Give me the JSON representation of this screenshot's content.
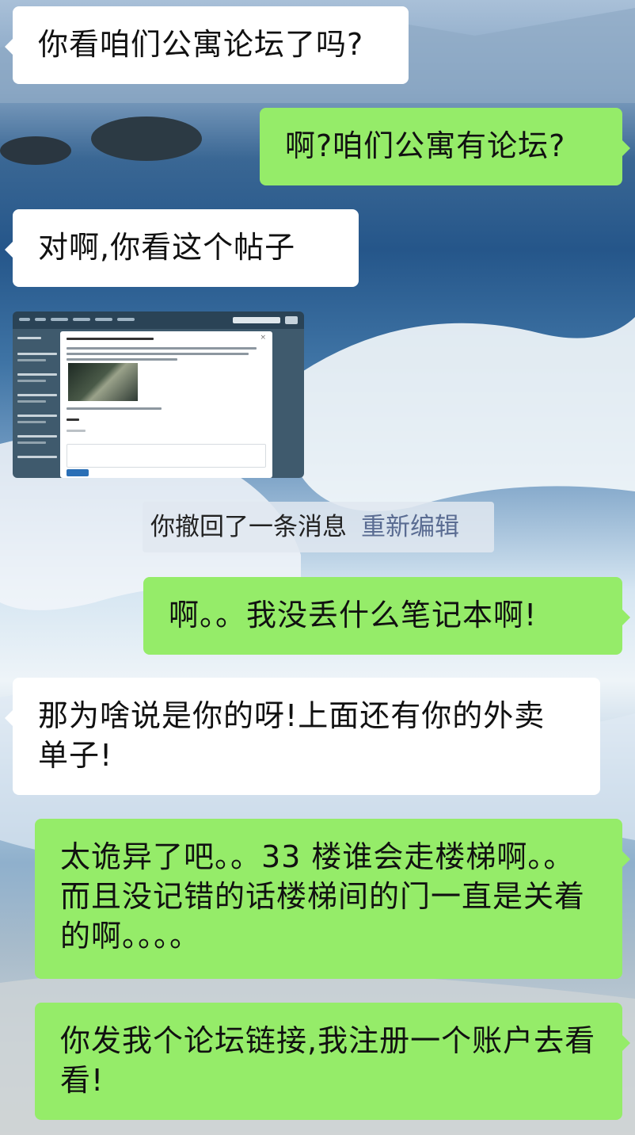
{
  "messages": [
    {
      "side": "left",
      "text": "你看咱们公寓论坛了吗?"
    },
    {
      "side": "right",
      "text": "啊?咱们公寓有论坛?"
    },
    {
      "side": "left",
      "text": "对啊,你看这个帖子"
    },
    {
      "side": "left",
      "type": "image",
      "image_icon": "forum-post-screenshot"
    },
    {
      "type": "system",
      "text": "你撤回了一条消息",
      "action": "重新编辑"
    },
    {
      "side": "right",
      "text": "啊。。我没丢什么笔记本啊!"
    },
    {
      "side": "left",
      "text": "那为啥说是你的呀!上面还有你的外卖单子!"
    },
    {
      "side": "right",
      "text": "太诡异了吧。。33 楼谁会走楼梯啊。。而且没记错的话楼梯间的门一直是关着的啊。。。。"
    },
    {
      "side": "right",
      "text": "你发我个论坛链接,我注册一个账户去看看!"
    }
  ],
  "colors": {
    "left_bubble": "#ffffff",
    "right_bubble": "#95ec69",
    "recall_action": "#5a6c92"
  }
}
